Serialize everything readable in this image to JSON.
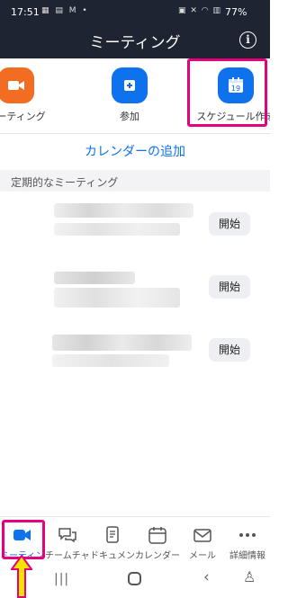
{
  "status_bar": {
    "time": "17:51",
    "app_indicators": "▦ ▤ M •",
    "system_indicators": "▣ ✕ ◠ ▥",
    "battery": "77%"
  },
  "header": {
    "title": "ミーティング",
    "info_icon": "i"
  },
  "quick_actions": [
    {
      "label": "ミーティング",
      "icon": "video-camera-icon",
      "color": "#f26c22"
    },
    {
      "label": "参加",
      "icon": "plus-icon",
      "color": "#0e72ed"
    },
    {
      "label": "スケジュール作成",
      "icon": "calendar-icon",
      "color": "#0e72ed"
    }
  ],
  "calendar_day_number": "19",
  "add_calendar_link": "カレンダーの追加",
  "section_title": "定期的なミーティング",
  "meetings": [
    {
      "start_label": "開始"
    },
    {
      "start_label": "開始"
    },
    {
      "start_label": "開始"
    }
  ],
  "tabs": [
    {
      "label": "ミーティング",
      "icon": "video-camera-icon",
      "active": true
    },
    {
      "label": "チームチャット",
      "icon": "chat-icon",
      "active": false
    },
    {
      "label": "ドキュメント",
      "icon": "document-icon",
      "active": false
    },
    {
      "label": "カレンダー",
      "icon": "calendar-icon",
      "active": false
    },
    {
      "label": "メール",
      "icon": "mail-icon",
      "active": false
    },
    {
      "label": "詳細情報",
      "icon": "more-icon",
      "active": false
    }
  ],
  "colors": {
    "header_bg": "#1f2433",
    "accent": "#0e72ed",
    "highlight": "#e5007e",
    "arrow": "#f5e400"
  }
}
